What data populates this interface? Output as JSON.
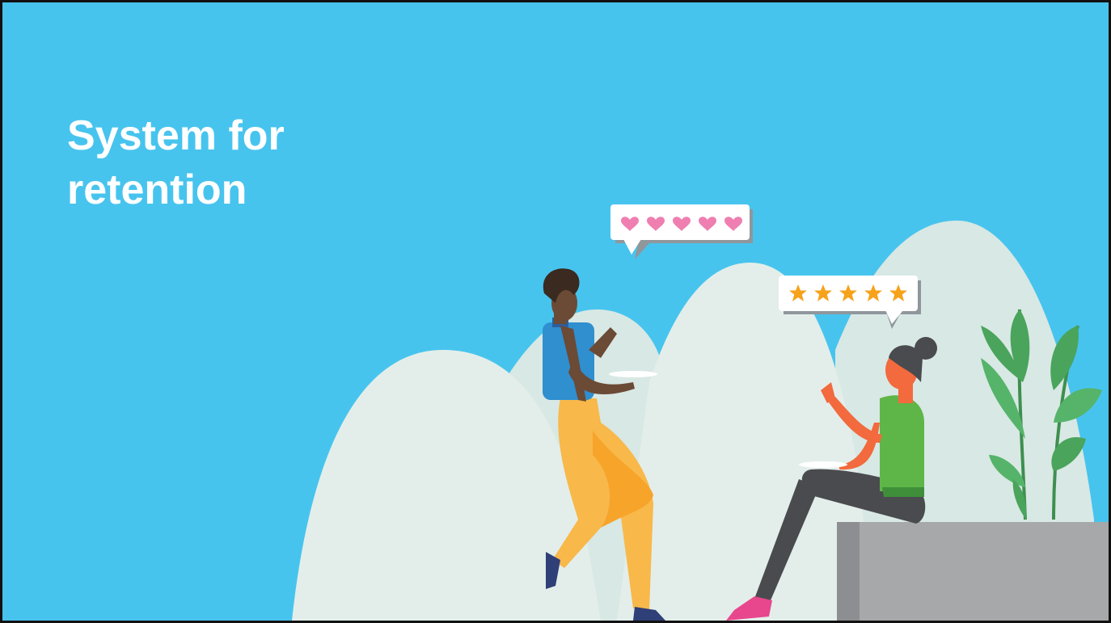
{
  "slide": {
    "title_lines": [
      "System for",
      "retention"
    ]
  },
  "illustration": {
    "hearts_bubble": {
      "icon": "heart-icon",
      "count": 5,
      "color": "#ef7fb1"
    },
    "stars_bubble": {
      "icon": "star-icon",
      "count": 5,
      "color": "#f6a21a"
    },
    "colors": {
      "background": "#47c4ee",
      "hills": "#e3eeea",
      "plant": "#4aa45c",
      "seat": "#a7a8aa"
    }
  }
}
